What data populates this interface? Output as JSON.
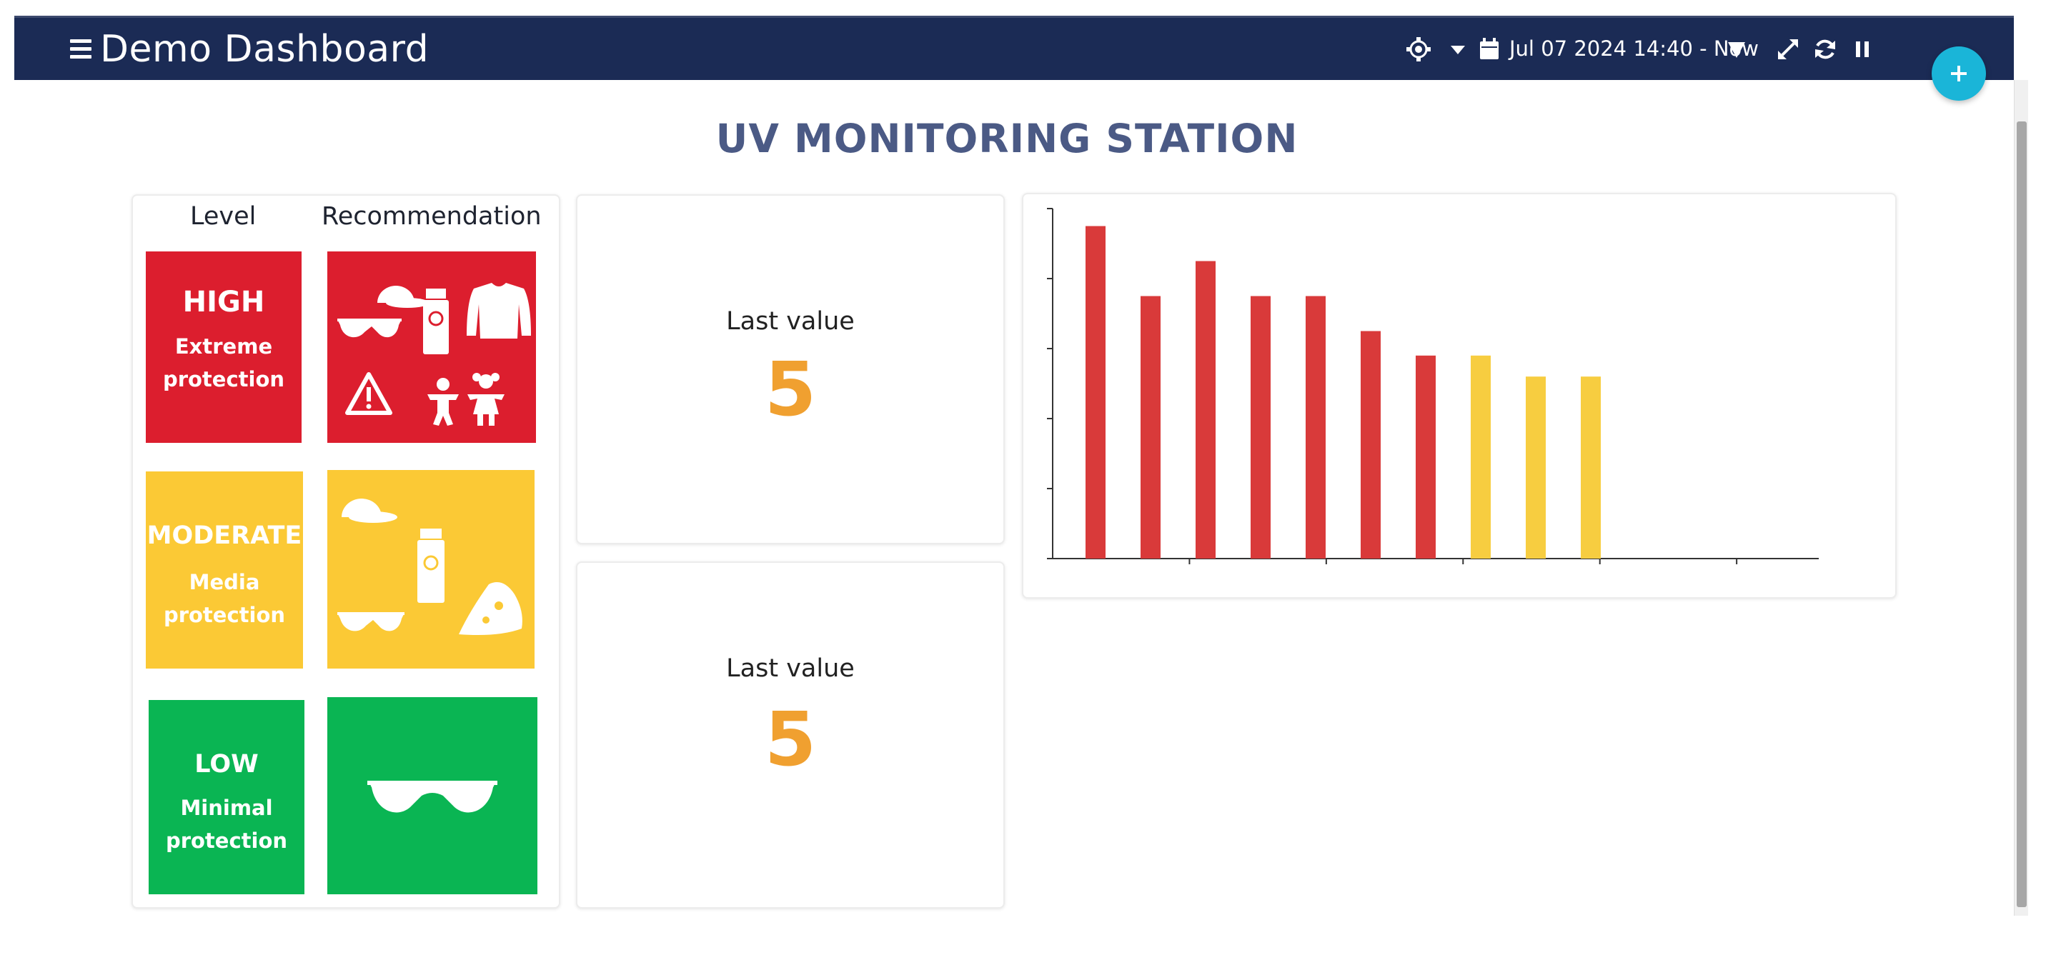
{
  "header": {
    "title": "Demo Dashboard",
    "date_range": "Jul 07 2024 14:40 - Now"
  },
  "page": {
    "title": "UV MONITORING STATION"
  },
  "uv_table": {
    "level_header": "Level",
    "recommendation_header": "Recommendation",
    "levels": [
      {
        "name": "HIGH",
        "desc_line1": "Extreme",
        "desc_line2": "protection",
        "color": "#dc1e2e"
      },
      {
        "name": "MODERATE",
        "desc_line1": "Media",
        "desc_line2": "protection",
        "color": "#fbc935"
      },
      {
        "name": "LOW",
        "desc_line1": "Minimal",
        "desc_line2": "protection",
        "color": "#0ab553"
      }
    ]
  },
  "kpis": [
    {
      "label": "Last value",
      "value": "5"
    },
    {
      "label": "Last value",
      "value": "5"
    }
  ],
  "colors": {
    "header_bg": "#1b2b55",
    "accent": "#1ab5d8",
    "kpi_value": "#f0a030",
    "bar_high": "#d93a3a",
    "bar_moderate": "#f7cd40"
  },
  "chart_data": {
    "type": "bar",
    "values": [
      9.5,
      7.5,
      8.5,
      7.5,
      7.5,
      6.5,
      5.8,
      5.8,
      5.2,
      5.2
    ],
    "bar_colors": [
      "#d93a3a",
      "#d93a3a",
      "#d93a3a",
      "#d93a3a",
      "#d93a3a",
      "#d93a3a",
      "#d93a3a",
      "#f7cd40",
      "#f7cd40",
      "#f7cd40"
    ],
    "ylim": [
      0,
      10
    ],
    "grid": false,
    "title": "",
    "xlabel": "",
    "ylabel": ""
  }
}
